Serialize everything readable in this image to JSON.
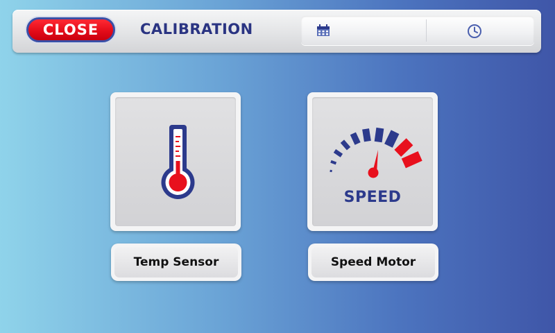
{
  "header": {
    "close_label": "CLOSE",
    "title": "CALIBRATION",
    "date_icon": "calendar-icon",
    "time_icon": "clock-icon",
    "date_value": "",
    "time_value": ""
  },
  "tiles": [
    {
      "icon": "thermometer-icon",
      "label": "Temp Sensor"
    },
    {
      "icon": "speedometer-icon",
      "gauge_text": "SPEED",
      "label": "Speed Motor"
    }
  ],
  "colors": {
    "accent_red": "#e8101d",
    "navy": "#2c3a8c",
    "background_left": "#8fd3ea",
    "background_right": "#3f56a8"
  }
}
